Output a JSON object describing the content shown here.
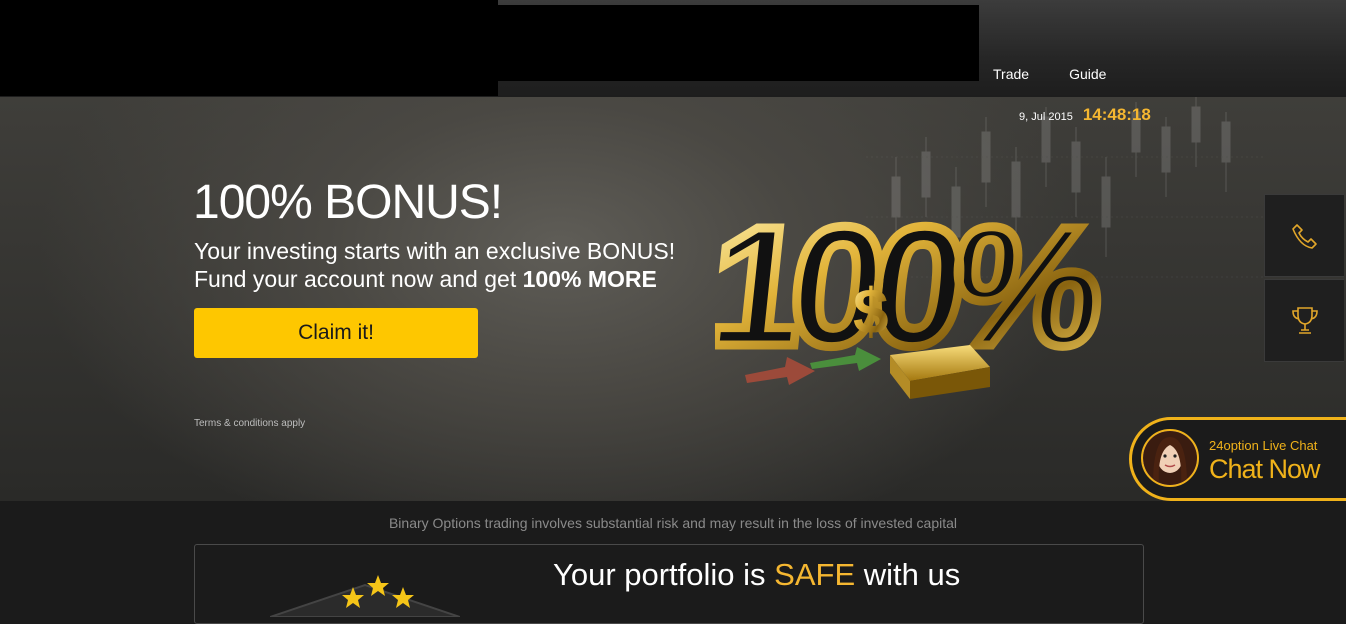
{
  "nav": {
    "items": [
      "Trade",
      "Guide"
    ]
  },
  "clock": {
    "date": "9, Jul 2015",
    "time": "14:48:18"
  },
  "hero": {
    "title": "100% BONUS!",
    "subtitle_line1": "Your investing starts with an exclusive BONUS!",
    "subtitle_line2_prefix": "Fund your account now and get ",
    "subtitle_line2_emphasis": "100% MORE",
    "cta_label": "Claim it!",
    "terms": "Terms & conditions apply",
    "art_text": "100%",
    "art_symbol": "$"
  },
  "side_tools": {
    "icons": [
      "phone-icon",
      "trophy-icon"
    ]
  },
  "chat": {
    "label": "24option Live Chat",
    "cta": "Chat Now"
  },
  "risk_warning": "Binary Options trading involves substantial risk and may result in the loss of invested capital",
  "portfolio": {
    "title_prefix": "Your portfolio is ",
    "title_emphasis": "SAFE",
    "title_suffix": " with us"
  },
  "colors": {
    "accent": "#fec700",
    "gold_text": "#f5b731",
    "background": "#1b1b1b"
  }
}
